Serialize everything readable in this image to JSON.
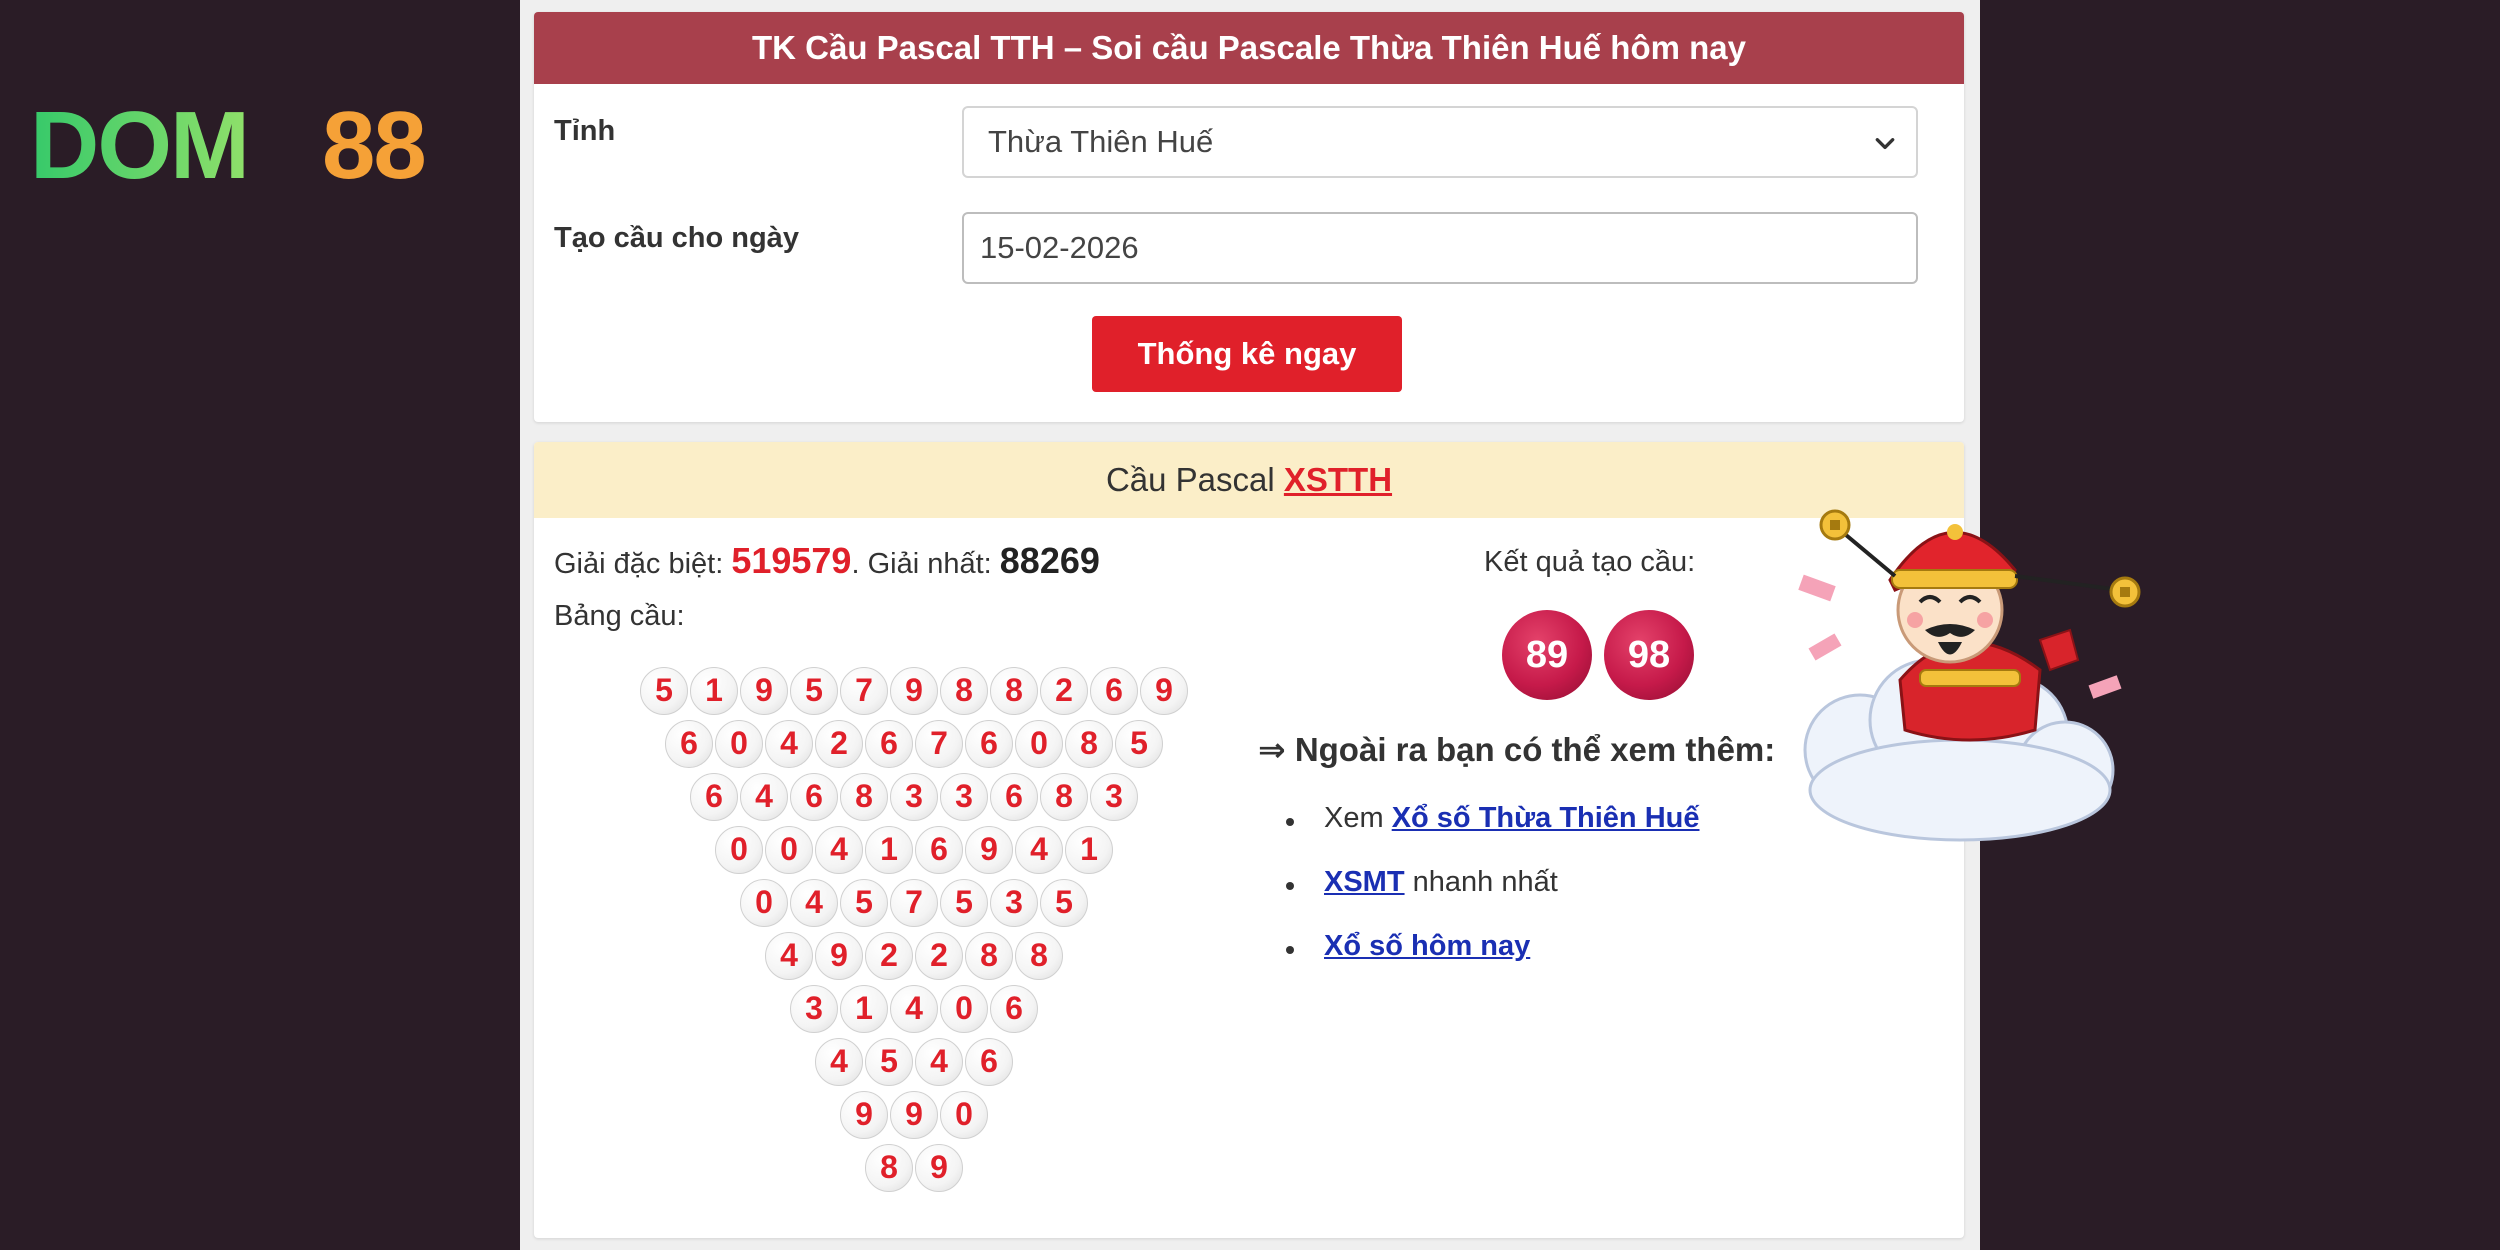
{
  "logo": {
    "text": "DOM88",
    "brand_green": "#3ccf6b",
    "brand_orange": "#f5a137"
  },
  "form": {
    "title": "TK Cầu Pascal TTH – Soi cầu Pascale Thừa Thiên Huế hôm nay",
    "province_label": "Tỉnh",
    "province_value": "Thừa Thiên Huế",
    "date_label": "Tạo cầu cho ngày",
    "date_value": "15-02-2026",
    "submit_label": "Thống kê ngay"
  },
  "result": {
    "header_prefix": "Cầu Pascal ",
    "header_link": "XSTTH",
    "special_label": "Giải đặc biệt: ",
    "special_value": "519579",
    "first_label": ". Giải nhất: ",
    "first_value": "88269",
    "table_label": "Bảng cầu:",
    "pascal_rows": [
      [
        5,
        1,
        9,
        5,
        7,
        9,
        8,
        8,
        2,
        6,
        9
      ],
      [
        6,
        0,
        4,
        2,
        6,
        7,
        6,
        0,
        8,
        5
      ],
      [
        6,
        4,
        6,
        8,
        3,
        3,
        6,
        8,
        3
      ],
      [
        0,
        0,
        4,
        1,
        6,
        9,
        4,
        1
      ],
      [
        0,
        4,
        5,
        7,
        5,
        3,
        5
      ],
      [
        4,
        9,
        2,
        2,
        8,
        8
      ],
      [
        3,
        1,
        4,
        0,
        6
      ],
      [
        4,
        5,
        4,
        6
      ],
      [
        9,
        9,
        0
      ],
      [
        8,
        9
      ]
    ],
    "output_title": "Kết quả tạo cầu:",
    "output_numbers": [
      "89",
      "98"
    ],
    "more_title": "⇒ Ngoài ra bạn có thể xem thêm:",
    "more_links": [
      {
        "prefix": "Xem ",
        "link": "Xổ số Thừa Thiên Huế",
        "suffix": ""
      },
      {
        "prefix": "",
        "link": "XSMT",
        "suffix": " nhanh nhất"
      },
      {
        "prefix": "",
        "link": "Xổ số hôm nay",
        "suffix": ""
      }
    ]
  },
  "colors": {
    "header_bg": "#a8404c",
    "button_bg": "#e0202a",
    "result_header_bg": "#fbeec8",
    "ball_number": "#e0202a",
    "result_ball": "#c61a4a",
    "link": "#1a2fb3",
    "background": "#2a1c26"
  },
  "icons": [
    "chevron-down-icon",
    "god-of-wealth-mascot"
  ]
}
